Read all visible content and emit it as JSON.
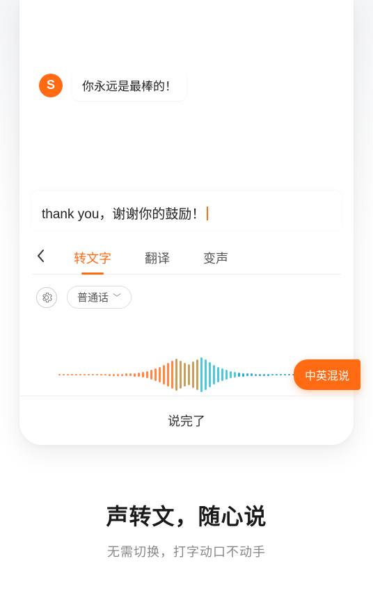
{
  "avatar_letter": "S",
  "chat_message": "你永远是最棒的！",
  "input_text": "thank you，谢谢你的鼓励！",
  "tabs": {
    "t0": "转文字",
    "t1": "翻译",
    "t2": "变声"
  },
  "language": "普通话",
  "badge": "中英混说",
  "done_label": "说完了",
  "promo": {
    "title": "声转文，随心说",
    "subtitle": "无需切换，打字动口不动手"
  },
  "colors": {
    "accent": "#ff6a13"
  }
}
